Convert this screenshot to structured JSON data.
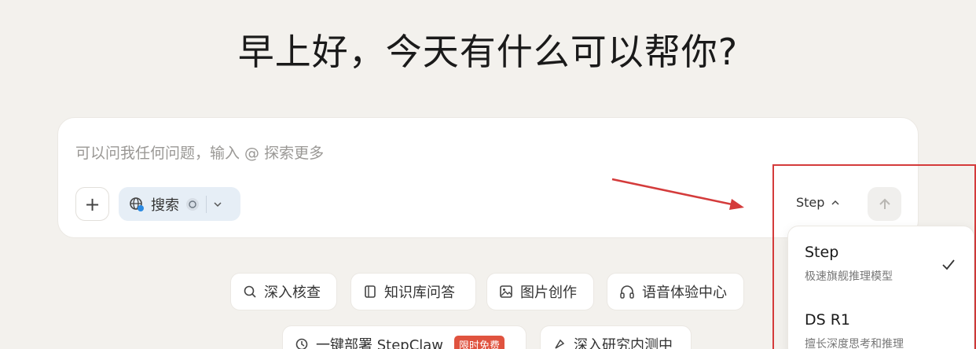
{
  "greeting": "早上好，今天有什么可以帮你?",
  "composer": {
    "placeholder": "可以问我任何问题，输入 @ 探索更多",
    "add_label": "+",
    "search_label": "搜索"
  },
  "model_selector": {
    "current": "Step",
    "options": [
      {
        "name": "Step",
        "description": "极速旗舰推理模型",
        "selected": true
      },
      {
        "name": "DS R1",
        "description": "擅长深度思考和推理",
        "selected": false
      }
    ]
  },
  "quick_actions": [
    {
      "label": "深入核查",
      "icon": "search-icon"
    },
    {
      "label": "知识库问答",
      "icon": "book-icon"
    },
    {
      "label": "图片创作",
      "icon": "image-icon"
    },
    {
      "label": "语音体验中心",
      "icon": "headphones-icon"
    },
    {
      "label": "一键部署 StepClaw",
      "icon": "deploy-icon",
      "tag": "限时免费"
    },
    {
      "label": "深入研究内测中",
      "icon": "research-icon"
    }
  ],
  "colors": {
    "background": "#f3f1ed",
    "annotation_red": "#d43b3b",
    "search_pill": "#e6eef6",
    "tag_red": "#e0533f"
  }
}
